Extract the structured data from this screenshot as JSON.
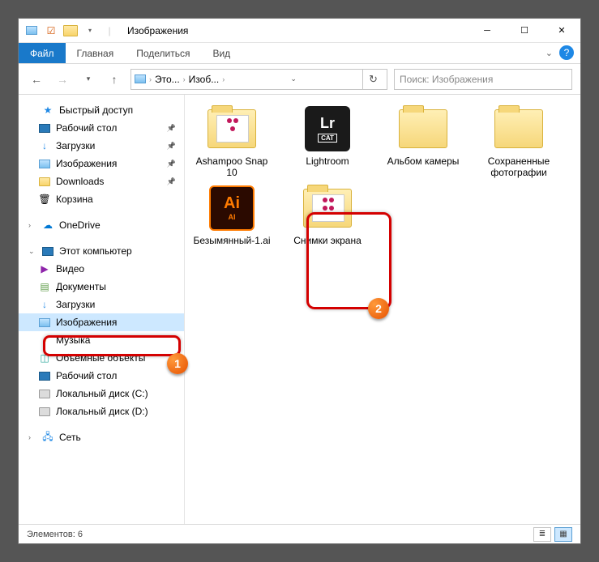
{
  "title": "Изображения",
  "tabs": {
    "file": "Файл",
    "home": "Главная",
    "share": "Поделиться",
    "view": "Вид"
  },
  "breadcrumb": {
    "pc": "Это...",
    "folder": "Изоб..."
  },
  "search_placeholder": "Поиск: Изображения",
  "sidebar": {
    "quick": "Быстрый доступ",
    "desktop": "Рабочий стол",
    "downloads": "Загрузки",
    "pictures": "Изображения",
    "downloads_en": "Downloads",
    "recycle": "Корзина",
    "onedrive": "OneDrive",
    "thispc": "Этот компьютер",
    "videos": "Видео",
    "documents": "Документы",
    "downloads2": "Загрузки",
    "pictures2": "Изображения",
    "music": "Музыка",
    "objects3d": "Объемные объекты",
    "desktop2": "Рабочий стол",
    "diskC": "Локальный диск (C:)",
    "diskD": "Локальный диск (D:)",
    "network": "Сеть"
  },
  "items": {
    "ashampoo": "Ashampoo Snap 10",
    "lightroom": "Lightroom",
    "camera": "Альбом камеры",
    "saved": "Сохраненные фотографии",
    "ai_file": "Безымянный-1.ai",
    "screenshots": "Снимки экрана"
  },
  "badges": {
    "one": "1",
    "two": "2"
  },
  "status": {
    "count_label": "Элементов:",
    "count": "6"
  },
  "icons": {
    "lr": "Lr",
    "cat": "CAT",
    "ai": "Ai",
    "ai_sub": "AI"
  }
}
